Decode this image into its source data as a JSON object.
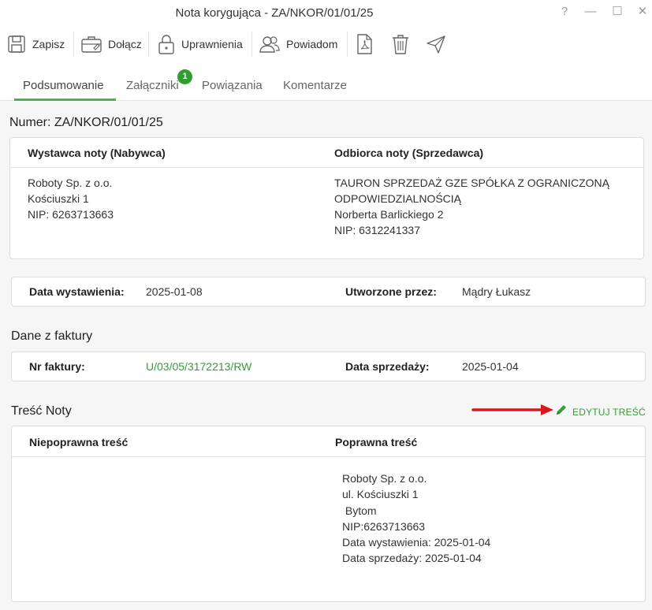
{
  "window": {
    "title": "Nota korygująca - ZA/NKOR/01/01/25",
    "help": "?",
    "minimize": "—",
    "maximize": "☐",
    "close": "✕"
  },
  "toolbar": {
    "save": "Zapisz",
    "attach": "Dołącz",
    "permissions": "Uprawnienia",
    "notify": "Powiadom"
  },
  "tabs": [
    {
      "label": "Podsumowanie",
      "active": true
    },
    {
      "label": "Załączniki",
      "badge": "1"
    },
    {
      "label": "Powiązania"
    },
    {
      "label": "Komentarze"
    }
  ],
  "document": {
    "number_label": "Numer: ZA/NKOR/01/01/25"
  },
  "parties": {
    "issuer_header": "Wystawca noty (Nabywca)",
    "recipient_header": "Odbiorca noty (Sprzedawca)",
    "issuer_lines": [
      "Roboty Sp. z o.o.",
      "Kościuszki 1",
      "NIP: 6263713663"
    ],
    "recipient_lines": [
      "TAURON SPRZEDAŻ GZE SPÓŁKA Z OGRANICZONĄ",
      "ODPOWIEDZIALNOŚCIĄ",
      "Norberta Barlickiego 2",
      "NIP: 6312241337"
    ]
  },
  "meta": {
    "issue_date_label": "Data wystawienia:",
    "issue_date": "2025-01-08",
    "created_by_label": "Utworzone przez:",
    "created_by": "Mądry Łukasz"
  },
  "invoice": {
    "section_title": "Dane z faktury",
    "number_label": "Nr faktury:",
    "number": "U/03/05/3172213/RW",
    "sale_date_label": "Data sprzedaży:",
    "sale_date": "2025-01-04"
  },
  "note_content": {
    "section_title": "Treść Noty",
    "edit_label": "EDYTUJ TREŚĆ",
    "incorrect_header": "Niepoprawna treść",
    "correct_header": "Poprawna treść",
    "correct_lines": [
      "Roboty Sp. z o.o.",
      "ul. Kościuszki 1",
      " Bytom",
      "NIP:6263713663",
      "Data wystawienia: 2025-01-04",
      "Data sprzedaży: 2025-01-04"
    ]
  },
  "colors": {
    "accent": "#4caf50",
    "link": "#3a9a3a",
    "arrow": "#d9181c"
  }
}
